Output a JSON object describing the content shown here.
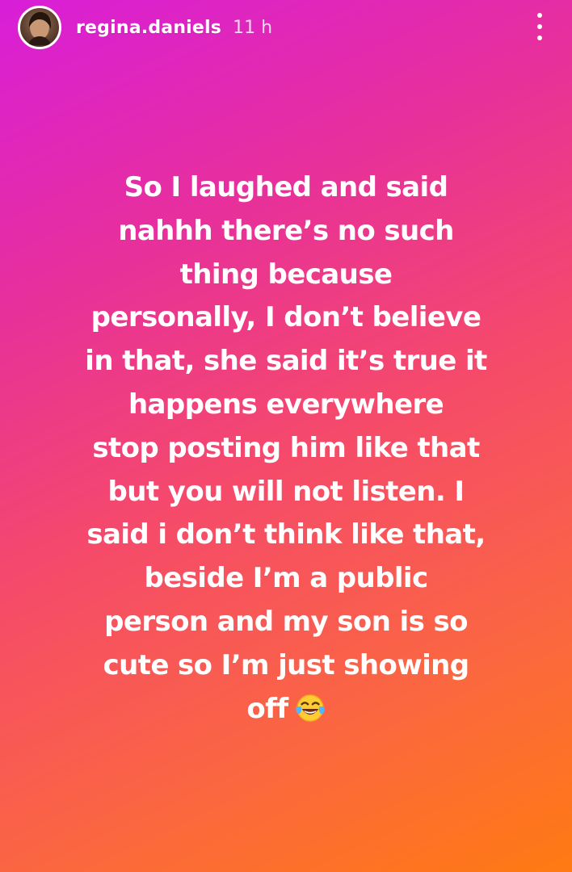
{
  "story": {
    "username": "regina.daniels",
    "timestamp": "11 h",
    "menu_icon": "more-vertical-icon",
    "avatar_icon": "profile-avatar",
    "text_lines": [
      "So I laughed and said",
      "nahhh there’s no such",
      "thing because",
      "personally, I don’t believe",
      "in that, she said it’s true it",
      "happens everywhere",
      "stop posting him like that",
      "but you will not listen. I",
      "said i don’t think like that,",
      "beside I’m a public",
      "person and my son is so",
      "cute so I’m just showing",
      "off"
    ],
    "emoji": "face-with-tears-of-joy-icon"
  },
  "colors": {
    "gradient_top_left": "#d81ed8",
    "gradient_bottom_right": "#ff7a12",
    "text": "#ffffff"
  }
}
